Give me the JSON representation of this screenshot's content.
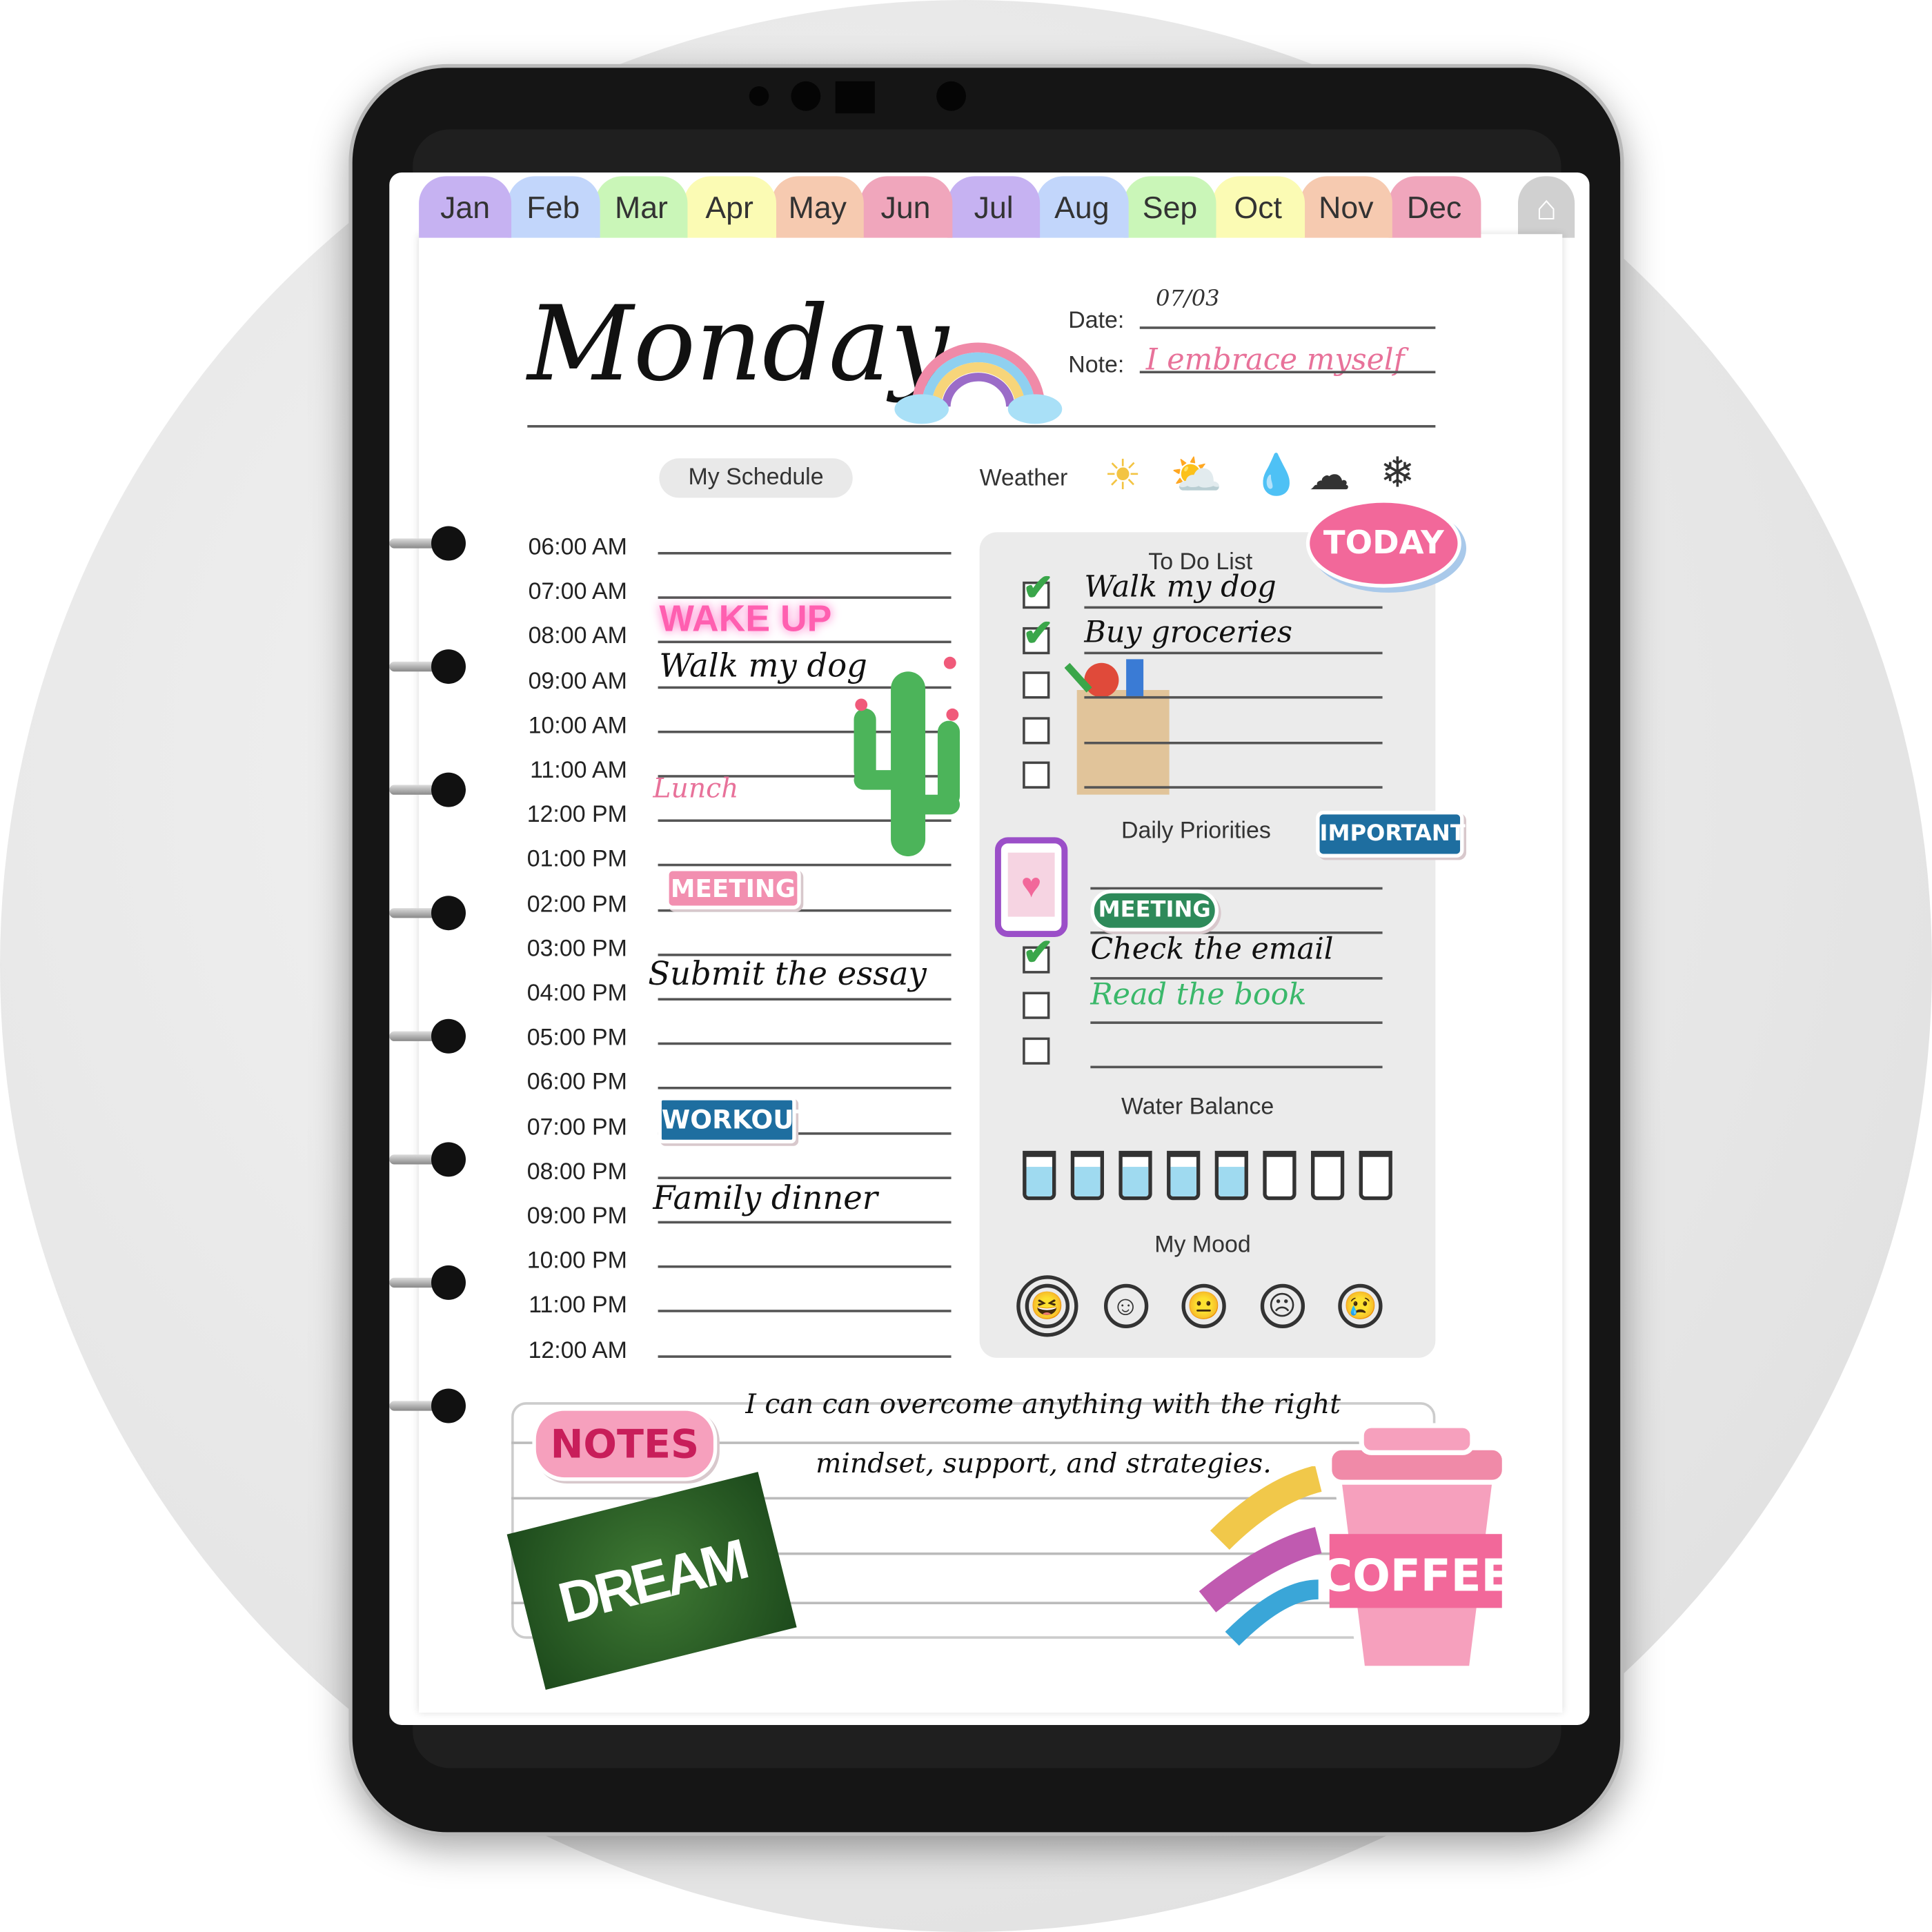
{
  "months": [
    {
      "label": "Jan",
      "color": "#c6b2f2"
    },
    {
      "label": "Feb",
      "color": "#c2d6fb"
    },
    {
      "label": "Mar",
      "color": "#caf6b8"
    },
    {
      "label": "Apr",
      "color": "#fbfbb4"
    },
    {
      "label": "May",
      "color": "#f6cab0"
    },
    {
      "label": "Jun",
      "color": "#f0a6bc"
    },
    {
      "label": "Jul",
      "color": "#c6b2f2"
    },
    {
      "label": "Aug",
      "color": "#c2d6fb"
    },
    {
      "label": "Sep",
      "color": "#caf6b8"
    },
    {
      "label": "Oct",
      "color": "#fbfbb4"
    },
    {
      "label": "Nov",
      "color": "#f6cab0"
    },
    {
      "label": "Dec",
      "color": "#f0a6bc"
    }
  ],
  "home_icon": "home-icon",
  "header": {
    "day": "Monday",
    "date_label": "Date:",
    "date_value": "07/03",
    "note_label": "Note:",
    "note_value": "I embrace myself"
  },
  "schedule": {
    "title": "My Schedule",
    "times": [
      "06:00 AM",
      "07:00 AM",
      "08:00 AM",
      "09:00 AM",
      "10:00 AM",
      "11:00 AM",
      "12:00 PM",
      "01:00 PM",
      "02:00 PM",
      "03:00 PM",
      "04:00 PM",
      "05:00 PM",
      "06:00 PM",
      "07:00 PM",
      "08:00 PM",
      "09:00 PM",
      "10:00 PM",
      "11:00 PM",
      "12:00 AM"
    ],
    "wake_up": "WAKE UP",
    "walk": "Walk my dog",
    "lunch": "Lunch",
    "meeting": "MEETING",
    "essay": "Submit the essay",
    "workout": "WORKOUT",
    "dinner": "Family dinner"
  },
  "weather": {
    "label": "Weather",
    "icons": [
      "sun-icon",
      "partly-cloudy-icon",
      "raindrop-icon",
      "cloud-icon",
      "snowflake-icon"
    ]
  },
  "todo": {
    "title": "To Do List",
    "sticker": "TODAY",
    "items": [
      {
        "text": "Walk my dog",
        "checked": true
      },
      {
        "text": "Buy groceries",
        "checked": true
      },
      {
        "text": "",
        "checked": false
      },
      {
        "text": "",
        "checked": false
      },
      {
        "text": "",
        "checked": false
      }
    ]
  },
  "priorities": {
    "title": "Daily Priorities",
    "sticker": "IMPORTANT",
    "meeting": "MEETING",
    "items": [
      {
        "text": "Check the email",
        "checked": true
      },
      {
        "text": "Read the book",
        "checked": false
      },
      {
        "text": "",
        "checked": false
      }
    ]
  },
  "water": {
    "title": "Water Balance",
    "glasses_total": 8,
    "glasses_filled": 5
  },
  "mood": {
    "title": "My Mood",
    "options": [
      "laughing-icon",
      "smile-icon",
      "neutral-icon",
      "sad-icon",
      "crying-icon"
    ],
    "selected": 0
  },
  "notes": {
    "sticker": "NOTES",
    "line1": "I can  can overcome anything with the right",
    "line2": "mindset, support, and strategies.",
    "dream": "DREAM",
    "coffee": "COFFEE"
  }
}
